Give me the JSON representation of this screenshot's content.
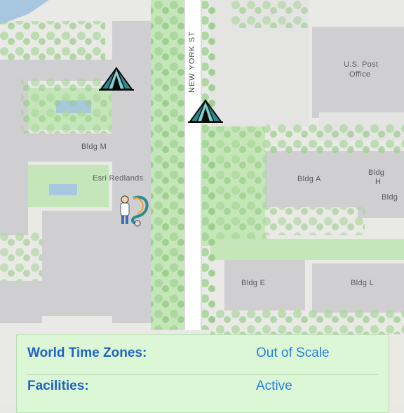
{
  "map": {
    "street_labels": {
      "new_york_st": "NEW YORK ST"
    },
    "building_labels": {
      "us_post_office_line1": "U.S. Post",
      "us_post_office_line2": "Office",
      "bldg_m": "Bldg M",
      "esri_redlands": "Esri Redlands",
      "bldg_a": "Bldg A",
      "bldg_h_line1": "Bldg",
      "bldg_h_line2": "H",
      "bldg_edge": "Bldg",
      "bldg_e": "Bldg E",
      "bldg_l": "Bldg L"
    },
    "markers": [
      {
        "icon": "tent-icon",
        "name": "campsite"
      },
      {
        "icon": "tent-icon",
        "name": "campsite"
      },
      {
        "icon": "doctor-stethoscope-icon",
        "name": "medical-facility"
      }
    ],
    "colors": {
      "building": "#cfcfd2",
      "ground": "#e9e9e6",
      "tree": "#9ed08f",
      "lawn": "#c5e6b9"
    }
  },
  "layer_panel": {
    "rows": [
      {
        "label": "World Time Zones:",
        "value": "Out of Scale"
      },
      {
        "label": "Facilities:",
        "value": "Active"
      }
    ],
    "colors": {
      "background": "#dcf7d6",
      "label": "#1e63c4",
      "value": "#2a7fe0"
    }
  }
}
